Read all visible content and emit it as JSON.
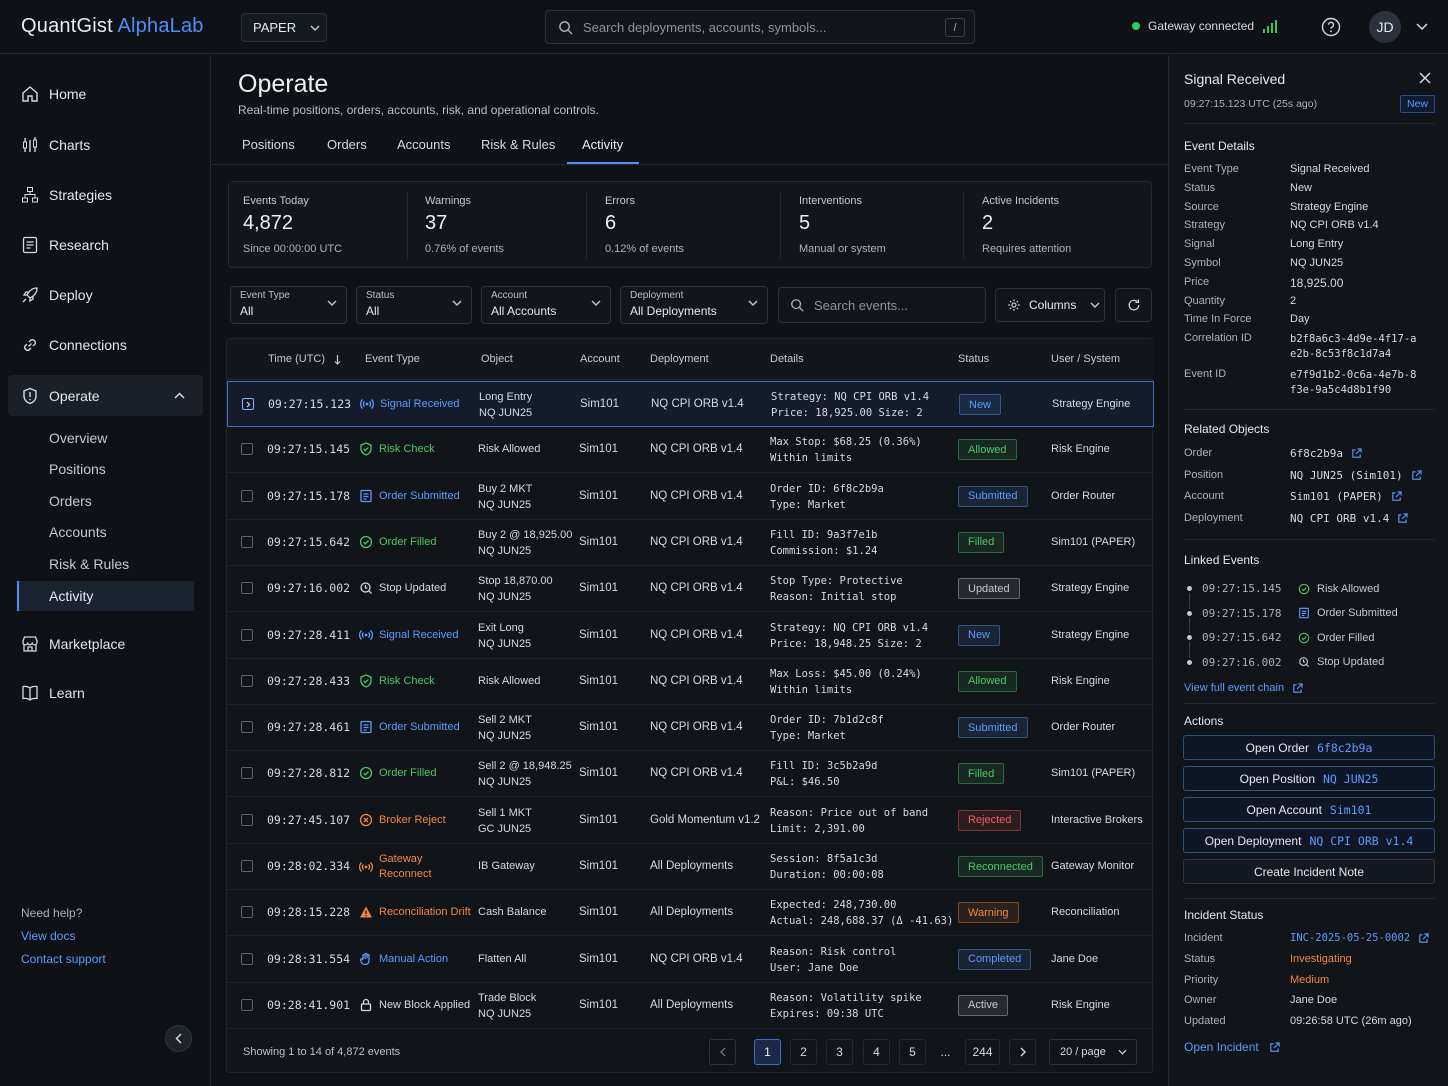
{
  "app": {
    "brand": "QuantGist",
    "brand_accent": "AlphaLab",
    "mode": "PAPER",
    "search_placeholder": "Search deployments, accounts, symbols...",
    "search_shortcut": "/",
    "gateway_status": "Gateway connected",
    "user_initials": "JD"
  },
  "colors": {
    "accent": "#4f8ff7",
    "success": "#37c45a",
    "warning": "#f0883e",
    "danger": "#f25f5c"
  },
  "sidebar": {
    "items": [
      {
        "label": "Home",
        "icon": "home-icon"
      },
      {
        "label": "Charts",
        "icon": "charts-icon"
      },
      {
        "label": "Strategies",
        "icon": "strategies-icon"
      },
      {
        "label": "Research",
        "icon": "research-icon"
      },
      {
        "label": "Deploy",
        "icon": "rocket-icon"
      },
      {
        "label": "Connections",
        "icon": "link-icon"
      },
      {
        "label": "Operate",
        "icon": "shield-icon"
      },
      {
        "label": "Marketplace",
        "icon": "store-icon"
      },
      {
        "label": "Learn",
        "icon": "book-icon"
      }
    ],
    "operate_sub": [
      "Overview",
      "Positions",
      "Orders",
      "Accounts",
      "Risk & Rules",
      "Activity"
    ],
    "help": {
      "title": "Need help?",
      "docs": "View docs",
      "support": "Contact support"
    }
  },
  "page": {
    "title": "Operate",
    "subtitle": "Real-time positions, orders, accounts, risk, and operational controls.",
    "tabs": [
      "Positions",
      "Orders",
      "Accounts",
      "Risk & Rules",
      "Activity"
    ],
    "active_tab": "Activity"
  },
  "stats": [
    {
      "label": "Events Today",
      "value": "4,872",
      "sub": "Since 00:00:00 UTC"
    },
    {
      "label": "Warnings",
      "value": "37",
      "sub": "0.76% of events"
    },
    {
      "label": "Errors",
      "value": "6",
      "sub": "0.12% of events"
    },
    {
      "label": "Interventions",
      "value": "5",
      "sub": "Manual or system"
    },
    {
      "label": "Active Incidents",
      "value": "2",
      "sub": "Requires attention"
    }
  ],
  "filters": {
    "event_type": {
      "label": "Event Type",
      "value": "All"
    },
    "status": {
      "label": "Status",
      "value": "All"
    },
    "account": {
      "label": "Account",
      "value": "All Accounts"
    },
    "deployment": {
      "label": "Deployment",
      "value": "All Deployments"
    },
    "search_placeholder": "Search events...",
    "columns_label": "Columns"
  },
  "table": {
    "columns": [
      "Time (UTC)",
      "Event Type",
      "Object",
      "Account",
      "Deployment",
      "Details",
      "Status",
      "User / System"
    ],
    "rows": [
      {
        "time": "09:27:15.123",
        "type": "Signal Received",
        "icon": "signal-icon",
        "tcolor": "#5c9bff",
        "obj1": "Long Entry",
        "obj2": "NQ JUN25",
        "account": "Sim101",
        "deployment": "NQ CPI ORB v1.4",
        "d1": "Strategy: NQ CPI ORB v1.4",
        "d2": "Price: 18,925.00  Size: 2",
        "status": "New",
        "scolor": "#5c9bff",
        "user": "Strategy Engine"
      },
      {
        "time": "09:27:15.145",
        "type": "Risk Check",
        "icon": "shield-check-icon",
        "tcolor": "#4cc767",
        "obj1": "Risk Allowed",
        "obj2": "",
        "account": "Sim101",
        "deployment": "NQ CPI ORB v1.4",
        "d1": "Max Stop: $68.25  (0.36%)",
        "d2": "Within limits",
        "status": "Allowed",
        "scolor": "#4cc767",
        "user": "Risk Engine"
      },
      {
        "time": "09:27:15.178",
        "type": "Order Submitted",
        "icon": "order-icon",
        "tcolor": "#5c9bff",
        "obj1": "Buy 2 MKT",
        "obj2": "NQ JUN25",
        "account": "Sim101",
        "deployment": "NQ CPI ORB v1.4",
        "d1": "Order ID: 6f8c2b9a",
        "d2": "Type: Market",
        "status": "Submitted",
        "scolor": "#5c9bff",
        "user": "Order Router"
      },
      {
        "time": "09:27:15.642",
        "type": "Order Filled",
        "icon": "check-circle-icon",
        "tcolor": "#4cc767",
        "obj1": "Buy 2 @ 18,925.00",
        "obj2": "NQ JUN25",
        "account": "Sim101",
        "deployment": "NQ CPI ORB v1.4",
        "d1": "Fill ID: 9a3f7e1b",
        "d2": "Commission: $1.24",
        "status": "Filled",
        "scolor": "#4cc767",
        "user": "Sim101 (PAPER)"
      },
      {
        "time": "09:27:16.002",
        "type": "Stop Updated",
        "icon": "stop-icon",
        "tcolor": "#d6dbe1",
        "obj1": "Stop 18,870.00",
        "obj2": "NQ JUN25",
        "account": "Sim101",
        "deployment": "NQ CPI ORB v1.4",
        "d1": "Stop Type: Protective",
        "d2": "Reason: Initial stop",
        "status": "Updated",
        "scolor": "#c4cad2",
        "user": "Strategy Engine"
      },
      {
        "time": "09:27:28.411",
        "type": "Signal Received",
        "icon": "signal-icon",
        "tcolor": "#5c9bff",
        "obj1": "Exit Long",
        "obj2": "NQ JUN25",
        "account": "Sim101",
        "deployment": "NQ CPI ORB v1.4",
        "d1": "Strategy: NQ CPI ORB v1.4",
        "d2": "Price: 18,948.25  Size: 2",
        "status": "New",
        "scolor": "#5c9bff",
        "user": "Strategy Engine"
      },
      {
        "time": "09:27:28.433",
        "type": "Risk Check",
        "icon": "shield-check-icon",
        "tcolor": "#4cc767",
        "obj1": "Risk Allowed",
        "obj2": "",
        "account": "Sim101",
        "deployment": "NQ CPI ORB v1.4",
        "d1": "Max Loss: $45.00  (0.24%)",
        "d2": "Within limits",
        "status": "Allowed",
        "scolor": "#4cc767",
        "user": "Risk Engine"
      },
      {
        "time": "09:27:28.461",
        "type": "Order Submitted",
        "icon": "order-icon",
        "tcolor": "#5c9bff",
        "obj1": "Sell 2 MKT",
        "obj2": "NQ JUN25",
        "account": "Sim101",
        "deployment": "NQ CPI ORB v1.4",
        "d1": "Order ID: 7b1d2c8f",
        "d2": "Type: Market",
        "status": "Submitted",
        "scolor": "#5c9bff",
        "user": "Order Router"
      },
      {
        "time": "09:27:28.812",
        "type": "Order Filled",
        "icon": "check-circle-icon",
        "tcolor": "#4cc767",
        "obj1": "Sell 2 @ 18,948.25",
        "obj2": "NQ JUN25",
        "account": "Sim101",
        "deployment": "NQ CPI ORB v1.4",
        "d1": "Fill ID: 3c5b2a9d",
        "d2": "P&L: $46.50",
        "status": "Filled",
        "scolor": "#4cc767",
        "user": "Sim101 (PAPER)"
      },
      {
        "time": "09:27:45.107",
        "type": "Broker Reject",
        "icon": "x-circle-icon",
        "tcolor": "#f0883e",
        "obj1": "Sell 1 MKT",
        "obj2": "GC JUN25",
        "account": "Sim101",
        "deployment": "Gold Momentum v1.2",
        "d1": "Reason: Price out of band",
        "d2": "Limit: 2,391.00",
        "status": "Rejected",
        "scolor": "#f25f5c",
        "user": "Interactive Brokers"
      },
      {
        "time": "09:28:02.334",
        "type": "Gateway Reconnect",
        "icon": "signal-icon",
        "tcolor": "#f0883e",
        "obj1": "IB Gateway",
        "obj2": "",
        "account": "Sim101",
        "deployment": "All Deployments",
        "d1": "Session: 8f5a1c3d",
        "d2": "Duration: 00:00:08",
        "status": "Reconnected",
        "scolor": "#4cc767",
        "user": "Gateway Monitor"
      },
      {
        "time": "09:28:15.228",
        "type": "Reconciliation Drift",
        "icon": "warning-icon",
        "tcolor": "#f0883e",
        "obj1": "Cash Balance",
        "obj2": "",
        "account": "Sim101",
        "deployment": "All Deployments",
        "d1": "Expected: 248,730.00",
        "d2": "Actual: 248,688.37  (Δ -41.63)",
        "status": "Warning",
        "scolor": "#f0883e",
        "user": "Reconciliation"
      },
      {
        "time": "09:28:31.554",
        "type": "Manual Action",
        "icon": "hand-icon",
        "tcolor": "#5c9bff",
        "obj1": "Flatten All",
        "obj2": "",
        "account": "Sim101",
        "deployment": "NQ CPI ORB v1.4",
        "d1": "Reason: Risk control",
        "d2": "User: Jane Doe",
        "status": "Completed",
        "scolor": "#5c9bff",
        "user": "Jane Doe"
      },
      {
        "time": "09:28:41.901",
        "type": "New Block Applied",
        "icon": "lock-icon",
        "tcolor": "#d6dbe1",
        "obj1": "Trade Block",
        "obj2": "NQ JUN25",
        "account": "Sim101",
        "deployment": "All Deployments",
        "d1": "Reason: Volatility spike",
        "d2": "Expires: 09:38 UTC",
        "status": "Active",
        "scolor": "#c4cad2",
        "user": "Risk Engine"
      }
    ],
    "footer": {
      "showing": "Showing 1 to 14 of 4,872 events",
      "pages": [
        "1",
        "2",
        "3",
        "4",
        "5",
        "...",
        "244"
      ],
      "per_page": "20 / page"
    }
  },
  "panel": {
    "title": "Signal Received",
    "time": "09:27:15.123 UTC (25s ago)",
    "badge": "New",
    "details_title": "Event Details",
    "details": [
      {
        "k": "Event Type",
        "v": "Signal Received"
      },
      {
        "k": "Status",
        "v": "New"
      },
      {
        "k": "Source",
        "v": "Strategy Engine"
      },
      {
        "k": "Strategy",
        "v": "NQ CPI ORB v1.4"
      },
      {
        "k": "Signal",
        "v": "Long Entry"
      },
      {
        "k": "Symbol",
        "v": "NQ JUN25"
      },
      {
        "k": "Price",
        "v": "18,925.00"
      },
      {
        "k": "Quantity",
        "v": "2"
      },
      {
        "k": "Time In Force",
        "v": "Day"
      },
      {
        "k": "Correlation ID",
        "v": "b2f8a6c3-4d9e-4f17-ae2b-8c53f8c1d7a4"
      },
      {
        "k": "Event ID",
        "v": "e7f9d1b2-0c6a-4e7b-8f3e-9a5c4d8b1f90"
      }
    ],
    "related_title": "Related Objects",
    "related": [
      {
        "k": "Order",
        "v": "6f8c2b9a"
      },
      {
        "k": "Position",
        "v": "NQ JUN25 (Sim101)"
      },
      {
        "k": "Account",
        "v": "Sim101 (PAPER)"
      },
      {
        "k": "Deployment",
        "v": "NQ CPI ORB v1.4"
      }
    ],
    "linked_title": "Linked Events",
    "linked": [
      {
        "time": "09:27:15.145",
        "label": "Risk Allowed",
        "icon": "check-circle-icon",
        "color": "#4cc767"
      },
      {
        "time": "09:27:15.178",
        "label": "Order Submitted",
        "icon": "order-icon",
        "color": "#5c9bff"
      },
      {
        "time": "09:27:15.642",
        "label": "Order Filled",
        "icon": "check-circle-icon",
        "color": "#4cc767"
      },
      {
        "time": "09:27:16.002",
        "label": "Stop Updated",
        "icon": "stop-icon",
        "color": "#c4cad2"
      }
    ],
    "view_chain": "View full event chain",
    "actions_title": "Actions",
    "actions": [
      {
        "label": "Open Order",
        "target": "6f8c2b9a"
      },
      {
        "label": "Open Position",
        "target": "NQ JUN25"
      },
      {
        "label": "Open Account",
        "target": "Sim101"
      },
      {
        "label": "Open Deployment",
        "target": "NQ CPI ORB v1.4"
      },
      {
        "label": "Create Incident Note",
        "target": ""
      }
    ],
    "incident_title": "Incident Status",
    "incident": [
      {
        "k": "Incident",
        "v": "INC-2025-05-25-0002"
      },
      {
        "k": "Status",
        "v": "Investigating"
      },
      {
        "k": "Priority",
        "v": "Medium"
      },
      {
        "k": "Owner",
        "v": "Jane Doe"
      },
      {
        "k": "Updated",
        "v": "09:26:58 UTC (26m ago)"
      }
    ],
    "open_incident": "Open Incident"
  }
}
